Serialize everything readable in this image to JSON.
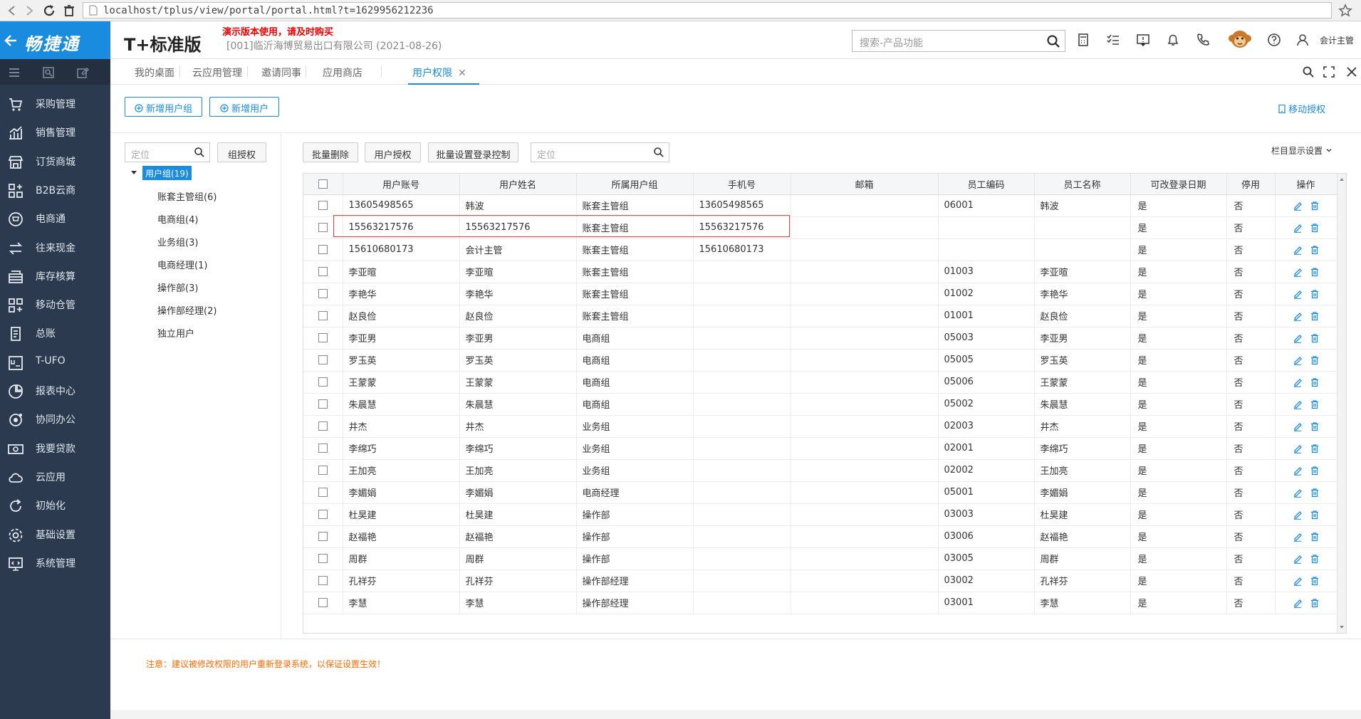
{
  "browser": {
    "url": "localhost/tplus/view/portal/portal.html?t=1629956212236"
  },
  "header": {
    "logo": "畅捷通",
    "product": "T+标准版",
    "demo_warning": "演示版本使用，请及时购买",
    "company": "[001]临沂海博贸易出口有限公司 (2021-08-26)",
    "search_placeholder": "搜索-产品功能",
    "user": "会计主管"
  },
  "sidebar": {
    "items": [
      {
        "label": "采购管理",
        "icon": "cart-icon"
      },
      {
        "label": "销售管理",
        "icon": "chart-icon"
      },
      {
        "label": "订货商城",
        "icon": "store-icon"
      },
      {
        "label": "B2B云商",
        "icon": "b2b-icon"
      },
      {
        "label": "电商通",
        "icon": "ecommerce-icon"
      },
      {
        "label": "往来现金",
        "icon": "exchange-icon"
      },
      {
        "label": "库存核算",
        "icon": "warehouse-icon"
      },
      {
        "label": "移动仓管",
        "icon": "mobile-warehouse-icon"
      },
      {
        "label": "总账",
        "icon": "ledger-icon"
      },
      {
        "label": "T-UFO",
        "icon": "ufo-icon"
      },
      {
        "label": "报表中心",
        "icon": "report-icon"
      },
      {
        "label": "协同办公",
        "icon": "collab-icon"
      },
      {
        "label": "我要贷款",
        "icon": "loan-icon"
      },
      {
        "label": "云应用",
        "icon": "cloud-icon"
      },
      {
        "label": "初始化",
        "icon": "refresh-icon"
      },
      {
        "label": "基础设置",
        "icon": "settings-icon"
      },
      {
        "label": "系统管理",
        "icon": "system-icon"
      }
    ]
  },
  "tabs": [
    {
      "label": "我的桌面"
    },
    {
      "label": "云应用管理"
    },
    {
      "label": "邀请同事"
    },
    {
      "label": "应用商店"
    },
    {
      "label": "用户权限",
      "close": "✕"
    }
  ],
  "toolbar": {
    "add_group": "新增用户组",
    "add_user": "新增用户",
    "mobile_auth": "移动授权"
  },
  "tree": {
    "search_placeholder": "定位",
    "group_auth": "组授权",
    "root": "用户组(19)",
    "nodes": [
      "账套主管组(6)",
      "电商组(4)",
      "业务组(3)",
      "电商经理(1)",
      "操作部(3)",
      "操作部经理(2)",
      "独立用户"
    ]
  },
  "table_toolbar": {
    "batch_delete": "批量删除",
    "user_auth": "用户授权",
    "batch_login": "批量设置登录控制",
    "search_placeholder": "定位",
    "column_settings": "栏目显示设置"
  },
  "table": {
    "headers": [
      "用户账号",
      "用户姓名",
      "所属用户组",
      "手机号",
      "邮箱",
      "员工编码",
      "员工名称",
      "可改登录日期",
      "停用",
      "操作"
    ],
    "rows": [
      [
        "13605498565",
        "韩波",
        "账套主管组",
        "13605498565",
        "",
        "06001",
        "韩波",
        "是",
        "否"
      ],
      [
        "15563217576",
        "15563217576",
        "账套主管组",
        "15563217576",
        "",
        "",
        "",
        "是",
        "否"
      ],
      [
        "15610680173",
        "会计主管",
        "账套主管组",
        "15610680173",
        "",
        "",
        "",
        "是",
        "否"
      ],
      [
        "李亚暄",
        "李亚暄",
        "账套主管组",
        "",
        "",
        "01003",
        "李亚暄",
        "是",
        "否"
      ],
      [
        "李艳华",
        "李艳华",
        "账套主管组",
        "",
        "",
        "01002",
        "李艳华",
        "是",
        "否"
      ],
      [
        "赵良俭",
        "赵良俭",
        "账套主管组",
        "",
        "",
        "01001",
        "赵良俭",
        "是",
        "否"
      ],
      [
        "李亚男",
        "李亚男",
        "电商组",
        "",
        "",
        "05003",
        "李亚男",
        "是",
        "否"
      ],
      [
        "罗玉英",
        "罗玉英",
        "电商组",
        "",
        "",
        "05005",
        "罗玉英",
        "是",
        "否"
      ],
      [
        "王蒙蒙",
        "王蒙蒙",
        "电商组",
        "",
        "",
        "05006",
        "王蒙蒙",
        "是",
        "否"
      ],
      [
        "朱晨慧",
        "朱晨慧",
        "电商组",
        "",
        "",
        "05002",
        "朱晨慧",
        "是",
        "否"
      ],
      [
        "井杰",
        "井杰",
        "业务组",
        "",
        "",
        "02003",
        "井杰",
        "是",
        "否"
      ],
      [
        "李绵巧",
        "李绵巧",
        "业务组",
        "",
        "",
        "02001",
        "李绵巧",
        "是",
        "否"
      ],
      [
        "王加亮",
        "王加亮",
        "业务组",
        "",
        "",
        "02002",
        "王加亮",
        "是",
        "否"
      ],
      [
        "李媚娟",
        "李媚娟",
        "电商经理",
        "",
        "",
        "05001",
        "李媚娟",
        "是",
        "否"
      ],
      [
        "杜昊建",
        "杜昊建",
        "操作部",
        "",
        "",
        "03003",
        "杜昊建",
        "是",
        "否"
      ],
      [
        "赵福艳",
        "赵福艳",
        "操作部",
        "",
        "",
        "03006",
        "赵福艳",
        "是",
        "否"
      ],
      [
        "周群",
        "周群",
        "操作部",
        "",
        "",
        "03005",
        "周群",
        "是",
        "否"
      ],
      [
        "孔祥芬",
        "孔祥芬",
        "操作部经理",
        "",
        "",
        "03002",
        "孔祥芬",
        "是",
        "否"
      ],
      [
        "李慧",
        "李慧",
        "操作部经理",
        "",
        "",
        "03001",
        "李慧",
        "是",
        "否"
      ]
    ]
  },
  "notice": "注意：建议被修改权限的用户重新登录系统，以保证设置生效！",
  "colors": {
    "accent": "#1a8ce0",
    "sidebar": "#2b3a4e",
    "warning": "#ff6a00",
    "highlight": "#e53935"
  }
}
